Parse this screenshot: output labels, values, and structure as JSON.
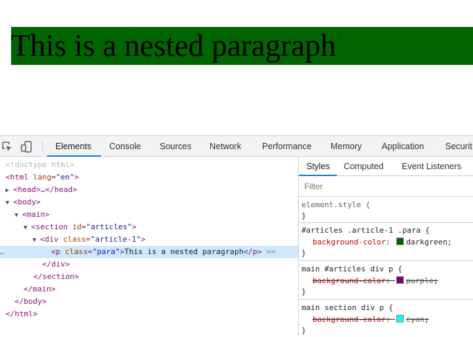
{
  "page": {
    "paragraph_text": "This is a nested paragraph",
    "paragraph_bg": "#006400"
  },
  "devtools": {
    "toolbar_icons": [
      "inspect-element-icon",
      "device-toggle-icon"
    ],
    "tabs": [
      "Elements",
      "Console",
      "Sources",
      "Network",
      "Performance",
      "Memory",
      "Application",
      "Securit"
    ],
    "active_tab": "Elements",
    "dom": {
      "doctype": "<!doctype html>",
      "html_open_tag": "<html ",
      "html_lang_attr": "lang",
      "html_lang_val": "\"en\"",
      "html_open_close": ">",
      "head": "<head>…</head>",
      "body_open": "<body>",
      "main_open": "<main>",
      "section_tag": "<section ",
      "section_attr": "id",
      "section_val": "\"articles\"",
      "section_close": ">",
      "div_tag": "<div ",
      "div_attr": "class",
      "div_val": "\"article-1\"",
      "div_close": ">",
      "p_tag": "<p ",
      "p_attr": "class",
      "p_val": "\"para\"",
      "p_close": ">",
      "p_text": "This is a nested paragraph",
      "p_end": "</p>",
      "selected_suffix": " ==",
      "selected_prefix": "…",
      "div_end": "</div>",
      "section_end": "</section>",
      "main_end": "</main>",
      "body_end": "</body>",
      "html_end": "</html>"
    },
    "styles": {
      "sub_tabs": [
        "Styles",
        "Computed",
        "Event Listeners"
      ],
      "active_sub_tab": "Styles",
      "filter_placeholder": "Filter",
      "rules": [
        {
          "selector": "element.style {",
          "close": "}",
          "properties": []
        },
        {
          "selector": "#articles .article-1 .para {",
          "close": "}",
          "properties": [
            {
              "name": "background-color",
              "value": "darkgreen",
              "swatch": "#006400",
              "overridden": false
            }
          ]
        },
        {
          "selector": "main #articles div p {",
          "close": "}",
          "properties": [
            {
              "name": "background-color",
              "value": "purple",
              "swatch": "#800080",
              "overridden": true
            }
          ]
        },
        {
          "selector": "main section div p {",
          "close": "}",
          "properties": [
            {
              "name": "background-color",
              "value": "cyan",
              "swatch": "#00ffff",
              "overridden": true
            }
          ]
        }
      ]
    }
  }
}
